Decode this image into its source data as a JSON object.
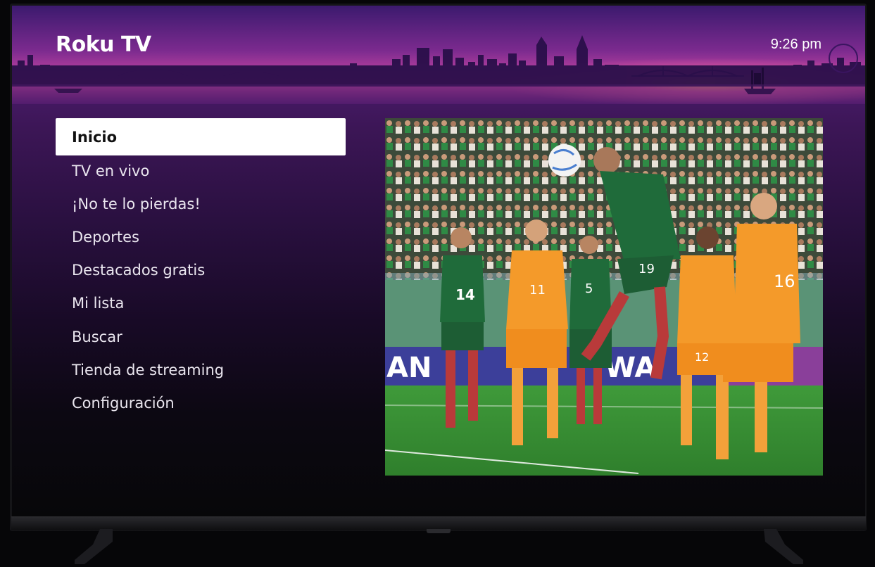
{
  "brand": {
    "logo": "Roku TV"
  },
  "status": {
    "time": "9:26 pm"
  },
  "menu": {
    "selected_index": 0,
    "items": [
      {
        "label": "Inicio"
      },
      {
        "label": "TV en vivo"
      },
      {
        "label": "¡No te lo pierdas!"
      },
      {
        "label": "Deportes"
      },
      {
        "label": "Destacados gratis"
      },
      {
        "label": "Mi lista"
      },
      {
        "label": "Buscar"
      },
      {
        "label": "Tienda de streaming"
      },
      {
        "label": "Configuración"
      }
    ]
  },
  "preview": {
    "ad_board_left": "AN",
    "ad_board_right": "WA",
    "players": [
      {
        "team": "green",
        "number": "14"
      },
      {
        "team": "orange",
        "number": "11"
      },
      {
        "team": "green",
        "number": "5"
      },
      {
        "team": "green",
        "number": "19"
      },
      {
        "team": "orange",
        "number": "12"
      },
      {
        "team": "orange",
        "number": "16"
      }
    ]
  },
  "colors": {
    "accent_purple": "#4a1b6c",
    "menu_highlight": "#ffffff",
    "team_green": "#1f6b3a",
    "team_orange": "#f49a2a"
  }
}
